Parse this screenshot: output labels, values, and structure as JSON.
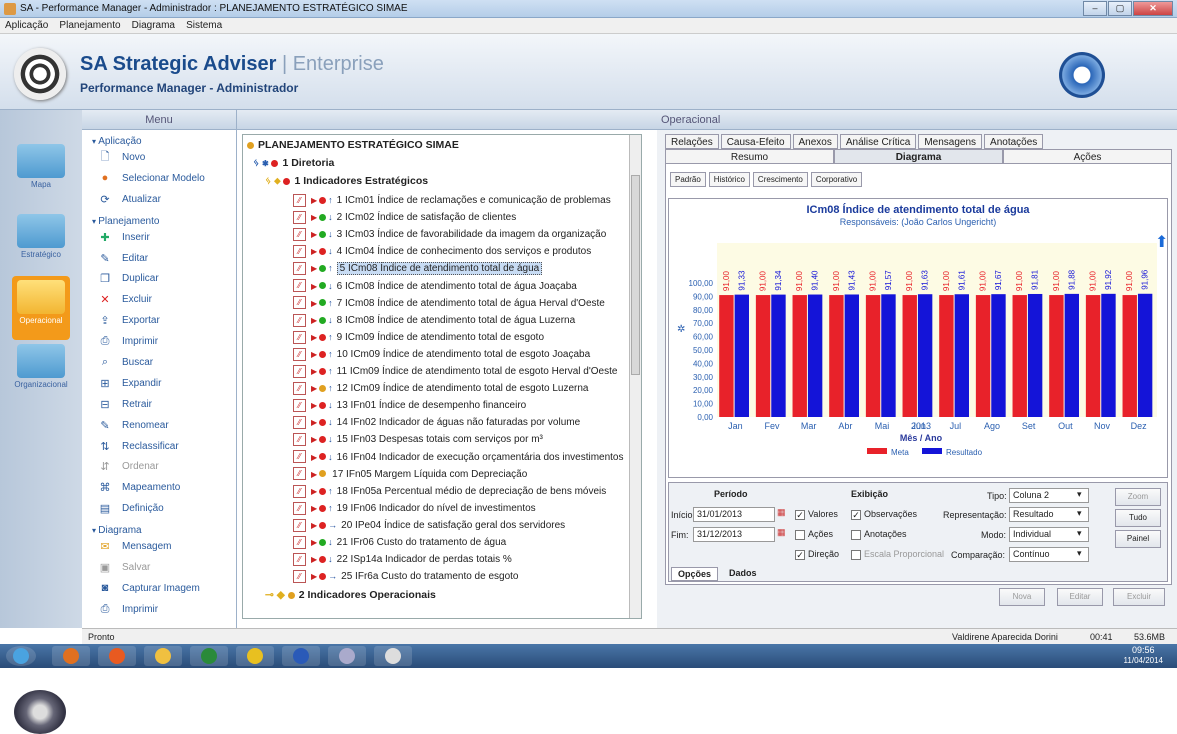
{
  "window": {
    "title": "SA - Performance Manager - Administrador : PLANEJAMENTO ESTRATÉGICO SIMAE",
    "controls": [
      "–",
      "▢",
      "✕"
    ]
  },
  "menubar": [
    "Aplicação",
    "Planejamento",
    "Diagrama",
    "Sistema"
  ],
  "banner": {
    "title": "SA Strategic Adviser",
    "title_suffix": "| Enterprise",
    "subtitle": "Performance Manager - Administrador"
  },
  "rail": [
    {
      "label": "Mapa"
    },
    {
      "label": "Estratégico"
    },
    {
      "label": "Operacional"
    },
    {
      "label": "Organizacional"
    }
  ],
  "menu": {
    "header": "Menu",
    "sections": [
      {
        "title": "Aplicação",
        "items": [
          "Novo",
          "Selecionar Modelo",
          "Atualizar"
        ]
      },
      {
        "title": "Planejamento",
        "items": [
          "Inserir",
          "Editar",
          "Duplicar",
          "Excluir",
          "Exportar",
          "Imprimir",
          "Buscar",
          "Expandir",
          "Retrair",
          "Renomear",
          "Reclassificar",
          "Ordenar",
          "Mapeamento",
          "Definição"
        ]
      },
      {
        "title": "Diagrama",
        "items": [
          "Mensagem",
          "Salvar",
          "Capturar Imagem",
          "Imprimir"
        ]
      }
    ]
  },
  "center_header": "Operacional",
  "tree": {
    "root": "PLANEJAMENTO ESTRATÉGICO SIMAE",
    "level1": "1 Diretoria",
    "level2": "1 Indicadores Estratégicos",
    "level2b": "2 Indicadores Operacionais",
    "items": [
      "1 ICm01 Índice de reclamações e comunicação de problemas",
      "2 ICm02 Índice de satisfação de clientes",
      "3 ICm03 Índice de favorabilidade da imagem da organização",
      "4 ICm04 Índice de conhecimento dos serviços e produtos",
      "5 ICm08 Índice de atendimento total de água",
      "6 ICm08 Índice de atendimento total de água Joaçaba",
      "7 ICm08 Índice de atendimento total de água Herval d'Oeste",
      "8 ICm08 Índice de atendimento total de água Luzerna",
      "9 ICm09 Índice de atendimento total de esgoto",
      "10 ICm09 Índice de atendimento total de esgoto Joaçaba",
      "11 ICm09 Índice de atendimento total de esgoto Herval d'Oeste",
      "12 ICm09 Índice de atendimento total de esgoto Luzerna",
      "13 IFn01 Índice de desempenho financeiro",
      "14 IFn02 Indicador de águas não faturadas por volume",
      "15 IFn03 Despesas totais com serviços por m³",
      "16 IFn04 Indicador de execução orçamentária dos investimentos",
      "17 IFn05 Margem Líquida com Depreciação",
      "18 IFn05a Percentual  médio de depreciação de bens móveis",
      "19 IFn06 Indicador do nível de investimentos",
      "20 IPe04 Índice de satisfação geral dos servidores",
      "21 IFr06 Custo do tratamento de água",
      "22 ISp14a Indicador de perdas totais %",
      "25 IFr6a Custo do tratamento de esgoto"
    ]
  },
  "tabs_top": [
    "Relações",
    "Causa-Efeito",
    "Anexos",
    "Análise Crítica",
    "Mensagens",
    "Anotações"
  ],
  "tabs_second": [
    "Resumo",
    "Diagrama",
    "Ações"
  ],
  "subtabs": [
    "Padrão",
    "Histórico",
    "Crescimento",
    "Corporativo"
  ],
  "chart_data": {
    "type": "bar",
    "title": "ICm08 Índice de atendimento total de água",
    "subtitle": "Responsáveis: (João Carlos Ungericht)",
    "categories": [
      "Jan",
      "Fev",
      "Mar",
      "Abr",
      "Mai",
      "Jun",
      "Jul",
      "Ago",
      "Set",
      "Out",
      "Nov",
      "Dez"
    ],
    "year": "2013",
    "xlabel": "Mês / Ano",
    "ylim": [
      0,
      100
    ],
    "yticks": [
      "0,00",
      "10,00",
      "20,00",
      "30,00",
      "40,00",
      "50,00",
      "60,00",
      "70,00",
      "80,00",
      "90,00",
      "100,00"
    ],
    "series": [
      {
        "name": "Meta",
        "color": "#e8222a",
        "values": [
          91.0,
          91.0,
          91.0,
          91.0,
          91.0,
          91.0,
          91.0,
          91.0,
          91.0,
          91.0,
          91.0,
          91.0
        ],
        "labels": [
          "91,00",
          "91,00",
          "91,00",
          "91,00",
          "91,00",
          "91,00",
          "91,00",
          "91,00",
          "91,00",
          "91,00",
          "91,00",
          "91,00"
        ]
      },
      {
        "name": "Resultado",
        "color": "#1414d8",
        "values": [
          91.33,
          91.34,
          91.4,
          91.43,
          91.57,
          91.63,
          91.61,
          91.67,
          91.81,
          91.88,
          91.92,
          91.96
        ],
        "labels": [
          "91,33",
          "91,34",
          "91,40",
          "91,43",
          "91,57",
          "91,63",
          "91,61",
          "91,67",
          "91,81",
          "91,88",
          "91,92",
          "91,96"
        ]
      }
    ]
  },
  "options": {
    "periodo": "Período",
    "inicio_label": "Início:",
    "inicio": "31/01/2013",
    "fim_label": "Fim:",
    "fim": "31/12/2013",
    "valores": "Valores",
    "acoes": "Ações",
    "direcao": "Direção",
    "exibicao": "Exibição",
    "observacoes": "Observações",
    "anotacoes": "Anotações",
    "escala": "Escala Proporcional",
    "tipo_label": "Tipo:",
    "tipo": "Coluna 2",
    "repr_label": "Representação:",
    "repr": "Resultado",
    "modo_label": "Modo:",
    "modo": "Individual",
    "comp_label": "Comparação:",
    "comp": "Contínuo",
    "zoom": "Zoom",
    "tudo": "Tudo",
    "painel": "Painel",
    "tab_opcoes": "Opções",
    "tab_dados": "Dados",
    "nova": "Nova",
    "editar": "Editar",
    "excluir": "Excluir"
  },
  "status": {
    "left": "Pronto",
    "user": "Valdirene Aparecida Dorini",
    "time": "00:41",
    "mem": "53.6MB"
  },
  "taskbar": {
    "clock": "09:56",
    "date": "11/04/2014"
  }
}
